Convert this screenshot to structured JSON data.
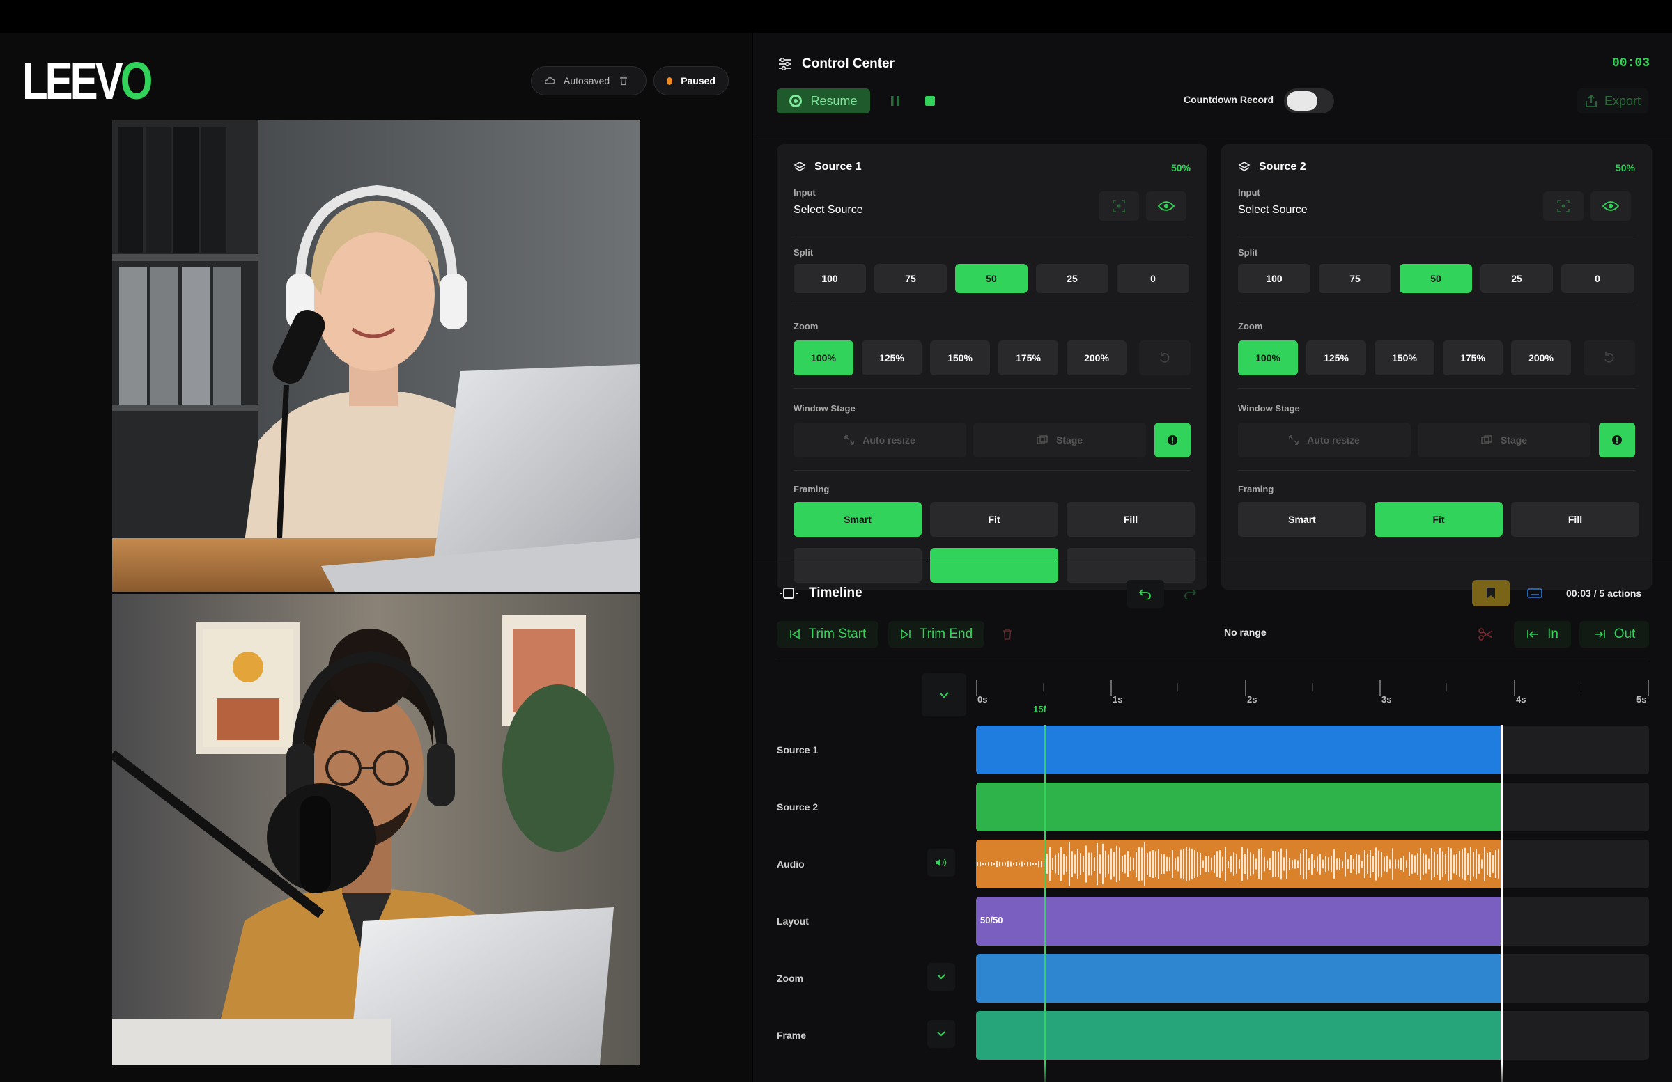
{
  "brand": {
    "logo_text": "LEEV",
    "logo_accent": "O"
  },
  "status": {
    "autosave_label": "Autosaved",
    "paused_label": "Paused"
  },
  "control_center": {
    "title": "Control Center",
    "timer": "00:03",
    "resume_label": "Resume",
    "countdown_label": "Countdown Record",
    "countdown_on": false,
    "export_label": "Export"
  },
  "sources": [
    {
      "title": "Source 1",
      "percent": "50%",
      "input_label": "Input",
      "input_value": "Select Source",
      "split_label": "Split",
      "split_options": [
        "100",
        "75",
        "50",
        "25",
        "0"
      ],
      "split_selected": "50",
      "zoom_label": "Zoom",
      "zoom_options": [
        "100%",
        "125%",
        "150%",
        "175%",
        "200%"
      ],
      "zoom_selected": "100%",
      "window_stage_label": "Window Stage",
      "auto_resize_label": "Auto resize",
      "stage_label": "Stage",
      "framing_label": "Framing",
      "framing_options": [
        "Smart",
        "Fit",
        "Fill"
      ],
      "framing_selected": "Smart"
    },
    {
      "title": "Source 2",
      "percent": "50%",
      "input_label": "Input",
      "input_value": "Select Source",
      "split_label": "Split",
      "split_options": [
        "100",
        "75",
        "50",
        "25",
        "0"
      ],
      "split_selected": "50",
      "zoom_label": "Zoom",
      "zoom_options": [
        "100%",
        "125%",
        "150%",
        "175%",
        "200%"
      ],
      "zoom_selected": "100%",
      "window_stage_label": "Window Stage",
      "auto_resize_label": "Auto resize",
      "stage_label": "Stage",
      "framing_label": "Framing",
      "framing_options": [
        "Smart",
        "Fit",
        "Fill"
      ],
      "framing_selected": "Fit"
    }
  ],
  "timeline": {
    "title": "Timeline",
    "actions_text": "00:03 / 5 actions",
    "trim_start_label": "Trim Start",
    "trim_end_label": "Trim End",
    "range_text": "No range",
    "in_label": "In",
    "out_label": "Out",
    "ruler_labels": [
      "0s",
      "1s",
      "2s",
      "3s",
      "4s",
      "5s"
    ],
    "playhead_label": "15f",
    "tracks": [
      {
        "name": "Source 1",
        "color": "#1f7de0",
        "text": ""
      },
      {
        "name": "Source 2",
        "color": "#2db34a",
        "text": ""
      },
      {
        "name": "Audio",
        "color": "#d9822b",
        "text": ""
      },
      {
        "name": "Layout",
        "color": "#7b5fc0",
        "text": "50/50"
      },
      {
        "name": "Zoom",
        "color": "#2f86d0",
        "text": ""
      },
      {
        "name": "Frame",
        "color": "#26a47a",
        "text": ""
      }
    ]
  },
  "colors": {
    "accent": "#31d35a",
    "paused_dot": "#f08a24",
    "bookmark": "#7a6418"
  },
  "icons": [
    "cloud-icon",
    "trash-icon",
    "sliders-icon",
    "pause-icon",
    "stop-icon",
    "export-icon",
    "layers-icon",
    "target-icon",
    "eye-icon",
    "reset-icon",
    "resize-icon",
    "stage-icon",
    "info-icon",
    "film-icon",
    "undo-icon",
    "redo-icon",
    "bookmark-icon",
    "keyboard-icon",
    "trim-start-icon",
    "trim-end-icon",
    "scissors-icon",
    "in-icon",
    "out-icon",
    "chevron-down-icon",
    "speaker-icon"
  ]
}
